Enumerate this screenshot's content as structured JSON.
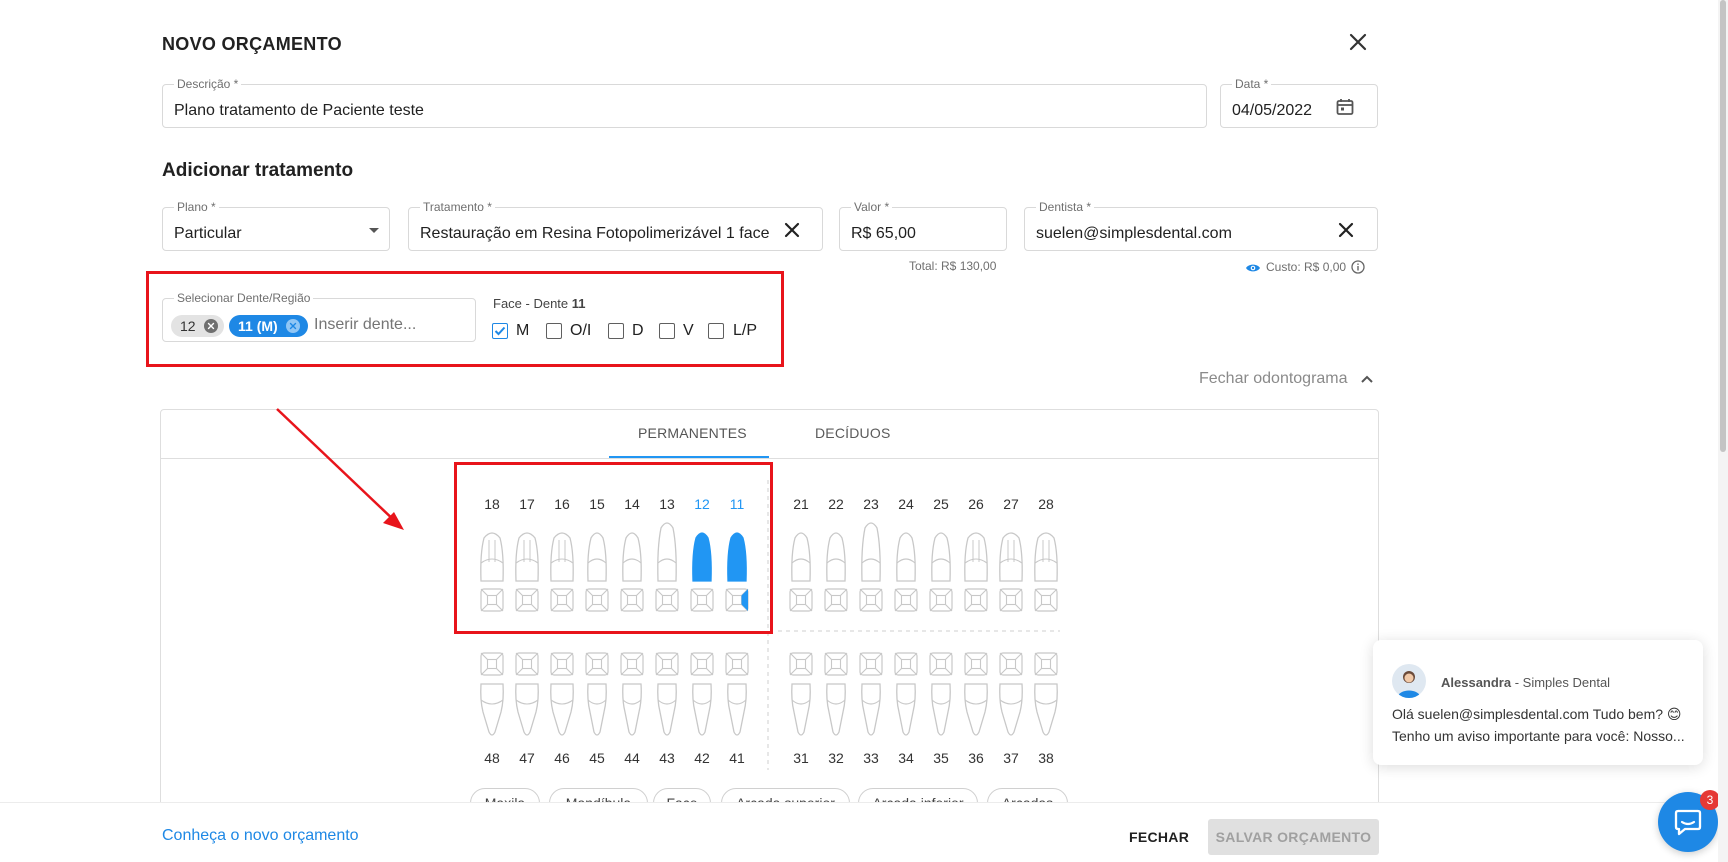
{
  "modal": {
    "title": "NOVO ORÇAMENTO",
    "close_icon": "close-icon"
  },
  "descricao": {
    "label": "Descrição *",
    "value": "Plano tratamento de Paciente teste"
  },
  "data_field": {
    "label": "Data *",
    "value": "04/05/2022",
    "icon": "calendar-icon"
  },
  "adicionar": {
    "title": "Adicionar tratamento",
    "plano": {
      "label": "Plano *",
      "value": "Particular"
    },
    "tratamento": {
      "label": "Tratamento *",
      "value": "Restauração em Resina Fotopolimerizável 1 face"
    },
    "valor": {
      "label": "Valor *",
      "value": "R$ 65,00",
      "total": "Total: R$ 130,00"
    },
    "dentista": {
      "label": "Dentista *",
      "value": "suelen@simplesdental.com",
      "custo": "Custo: R$ 0,00"
    }
  },
  "dente": {
    "label": "Selecionar Dente/Região",
    "placeholder": "Inserir dente...",
    "chips": [
      "12",
      "11 (M)"
    ]
  },
  "faces": {
    "title": "Face - Dente ",
    "title_number": "11",
    "options": [
      {
        "label": "M",
        "checked": true
      },
      {
        "label": "O/I",
        "checked": false
      },
      {
        "label": "D",
        "checked": false
      },
      {
        "label": "V",
        "checked": false
      },
      {
        "label": "L/P",
        "checked": false
      }
    ]
  },
  "odontograma": {
    "toggle_label": "Fechar odontograma",
    "tabs": [
      "PERMANENTES",
      "DECÍDUOS"
    ],
    "active_tab": "PERMANENTES",
    "upper": [
      "18",
      "17",
      "16",
      "15",
      "14",
      "13",
      "12",
      "11",
      "21",
      "22",
      "23",
      "24",
      "25",
      "26",
      "27",
      "28"
    ],
    "lower": [
      "48",
      "47",
      "46",
      "45",
      "44",
      "43",
      "42",
      "41",
      "31",
      "32",
      "33",
      "34",
      "35",
      "36",
      "37",
      "38"
    ],
    "selected": [
      "12",
      "11"
    ],
    "region_buttons": [
      "Maxila",
      "Mandíbula",
      "Face",
      "Arcada superior",
      "Arcada inferior",
      "Arcadas"
    ]
  },
  "footer": {
    "link": "Conheça o novo orçamento",
    "close": "FECHAR",
    "save": "SALVAR ORÇAMENTO"
  },
  "chat": {
    "sender": "Alessandra",
    "company": " - Simples Dental",
    "line1": "Olá suelen@simplesdental.com Tudo bem? 😊",
    "line2": "Tenho um aviso importante para você:  Nosso...",
    "badge": "3"
  },
  "colors": {
    "accent": "#2196f3",
    "annotation": "#e8141b",
    "link": "#1e88e5"
  }
}
